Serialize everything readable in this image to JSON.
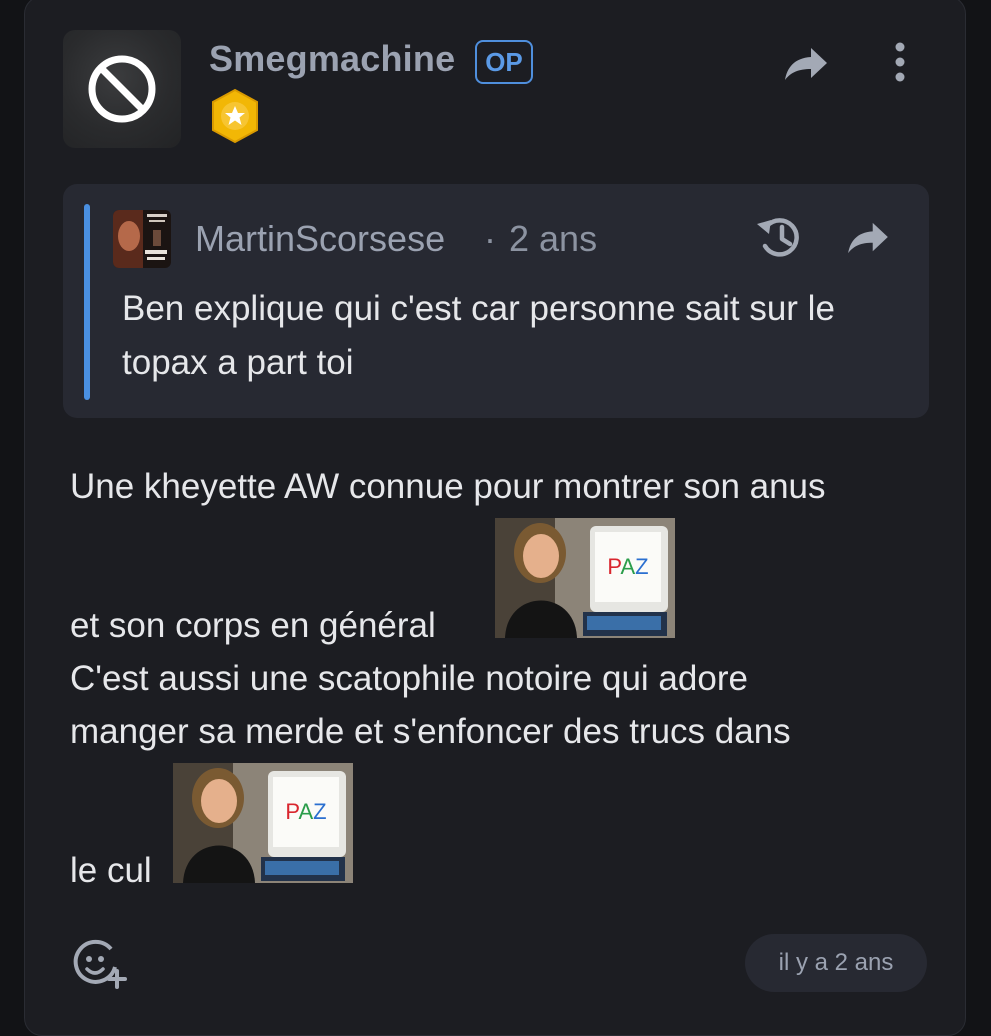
{
  "post": {
    "author": "Smegmachine",
    "op_label": "OP",
    "avatar_icon": "ban-icon",
    "rank_badge_icon": "star-badge-icon"
  },
  "quote": {
    "author": "MartinScorsese",
    "separator": "·",
    "time": "2 ans",
    "text": "Ben explique qui c'est car personne sait sur le topax a part toi"
  },
  "body": {
    "line1": "Une kheyette AW connue pour montrer son anus",
    "line2": "et son corps en général",
    "line3": "C'est aussi une scatophile notoire qui adore",
    "line4": "manger sa merde et s'enfoncer des trucs dans",
    "line5": "le cul",
    "sticker_text": "PAZ"
  },
  "footer": {
    "timestamp": "il y a 2 ans",
    "react_icon": "add-reaction-icon"
  },
  "colors": {
    "accent_blue": "#4a90e2",
    "badge_gold": "#f2b705",
    "background": "#1c1d22"
  }
}
